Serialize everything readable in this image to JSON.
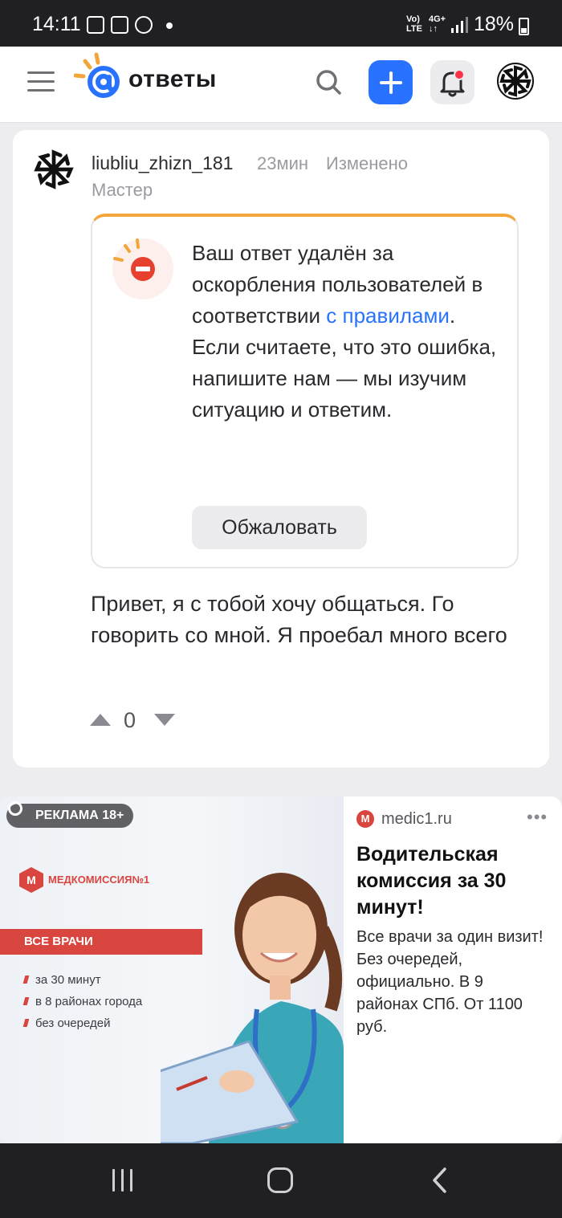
{
  "status_bar": {
    "time": "14:11",
    "network_top": "Vo)",
    "network_bottom": "LTE",
    "data_top": "4G+",
    "data_arrows": "↓↑",
    "battery": "18%"
  },
  "header": {
    "logo_text": "ответы",
    "icons": [
      "menu-icon",
      "search-icon",
      "plus-icon",
      "bell-icon",
      "avatar"
    ],
    "accent_color": "#2872ff",
    "logo_ray_color": "#f2a63a"
  },
  "answer": {
    "username": "liubliu_zhizn_181",
    "time": "23мин",
    "edited": "Изменено",
    "rank": "Мастер",
    "notice": {
      "text_before_link": "Ваш ответ удалён за оскорбления пользователей в соответствии ",
      "link_text": "с правилами",
      "text_after_link": ". Если считаете, что это ошибка, напишите нам — мы изучим ситуацию и ответим.",
      "appeal_button": "Обжаловать"
    },
    "body": "Привет, я с тобой хочу общаться. Го говорить со мной. Я проебал много всего",
    "votes": "0"
  },
  "ad": {
    "badge": "РЕКЛАМА 18+",
    "image_brand_mark": "М",
    "image_brand": "МЕДКОМИССИЯ№1",
    "image_stripe": "ВСЕ ВРАЧИ",
    "image_bullets": [
      "за 30 минут",
      "в 8 районах города",
      "без очередей"
    ],
    "domain_icon": "M",
    "domain": "medic1.ru",
    "more": "•••",
    "title": "Водительская комиссия за 30 минут!",
    "description": "Все врачи за один визит! Без очередей, официально. В 9 районах СПб. От 1100 руб.",
    "brand_color": "#d9453f"
  },
  "nav_bar": {
    "icons": [
      "recent-apps-icon",
      "home-icon",
      "back-icon"
    ]
  }
}
